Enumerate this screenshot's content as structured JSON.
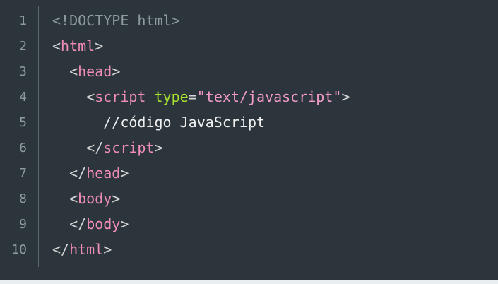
{
  "code": {
    "lines": [
      {
        "n": "1",
        "indent": "",
        "doctype": "<!DOCTYPE html>"
      },
      {
        "n": "2",
        "indent": "",
        "open": "<",
        "tag": "html",
        "close": ">"
      },
      {
        "n": "3",
        "indent": "  ",
        "open": "<",
        "tag": "head",
        "close": ">"
      },
      {
        "n": "4",
        "indent": "    ",
        "open": "<",
        "tag": "script",
        "space": " ",
        "attr": "type",
        "eq": "=",
        "str": "\"text/javascript\"",
        "close": ">"
      },
      {
        "n": "5",
        "indent": "      ",
        "plain": "//código JavaScript"
      },
      {
        "n": "6",
        "indent": "    ",
        "open": "</",
        "tag": "script",
        "close": ">"
      },
      {
        "n": "7",
        "indent": "  ",
        "open": "</",
        "tag": "head",
        "close": ">"
      },
      {
        "n": "8",
        "indent": "  ",
        "open": "<",
        "tag": "body",
        "close": ">"
      },
      {
        "n": "9",
        "indent": "  ",
        "open": "</",
        "tag": "body",
        "close": ">"
      },
      {
        "n": "10",
        "indent": "",
        "open": "</",
        "tag": "html",
        "close": ">"
      }
    ]
  },
  "colors": {
    "background": "#2b353b",
    "tag": "#f28eb6",
    "attribute": "#a6e22e",
    "string": "#f29ac7",
    "line_number": "#8f9aa0"
  }
}
